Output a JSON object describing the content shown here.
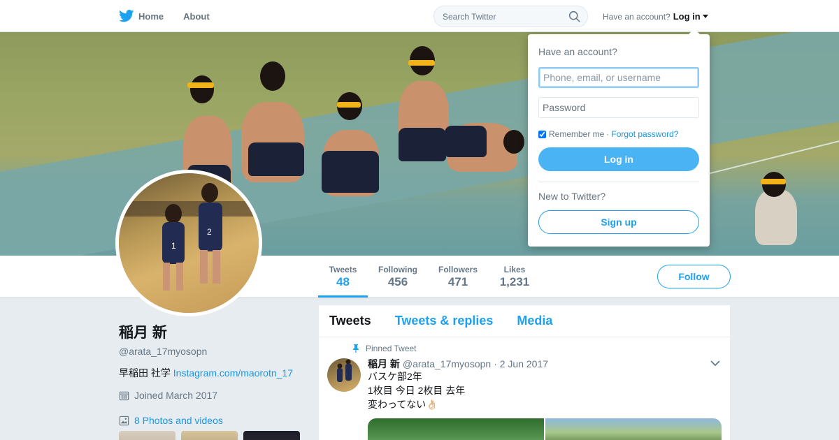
{
  "nav": {
    "home_label": "Home",
    "about_label": "About",
    "search_placeholder": "Search Twitter",
    "have_account": "Have an account?",
    "login_label": "Log in"
  },
  "profile": {
    "name": "稲月 新",
    "handle": "@arata_17myosopn",
    "bio_text": "早稲田 社学 ",
    "bio_link": "Instagram.com/maorotn_17",
    "joined": "Joined March 2017",
    "photos_label": "8 Photos and videos"
  },
  "stats": [
    {
      "label": "Tweets",
      "value": "48"
    },
    {
      "label": "Following",
      "value": "456"
    },
    {
      "label": "Followers",
      "value": "471"
    },
    {
      "label": "Likes",
      "value": "1,231"
    }
  ],
  "follow_label": "Follow",
  "timeline": {
    "tabs": [
      "Tweets",
      "Tweets & replies",
      "Media"
    ],
    "pinned_label": "Pinned Tweet",
    "tweet": {
      "name": "稲月 新",
      "handle": "@arata_17myosopn",
      "date": "· 2 Jun 2017",
      "lines": [
        "バスケ部2年",
        "1枚目 今日 2枚目 去年",
        "変わってない👌🏻"
      ]
    }
  },
  "login_dropdown": {
    "title": "Have an account?",
    "username_placeholder": "Phone, email, or username",
    "password_placeholder": "Password",
    "remember_label": "Remember me",
    "separator": "·",
    "forgot_label": "Forgot password?",
    "login_button": "Log in",
    "new_label": "New to Twitter?",
    "signup_button": "Sign up"
  },
  "colors": {
    "accent": "#1da1f2",
    "login_button": "#4ab3f4",
    "link": "#1b95e0",
    "background": "#e6ecf0"
  },
  "icons": {
    "logo": "twitter-bird-icon",
    "search": "search-icon",
    "calendar": "calendar-icon",
    "photo": "photo-icon",
    "pin": "pin-icon",
    "chevron": "chevron-down-icon"
  }
}
